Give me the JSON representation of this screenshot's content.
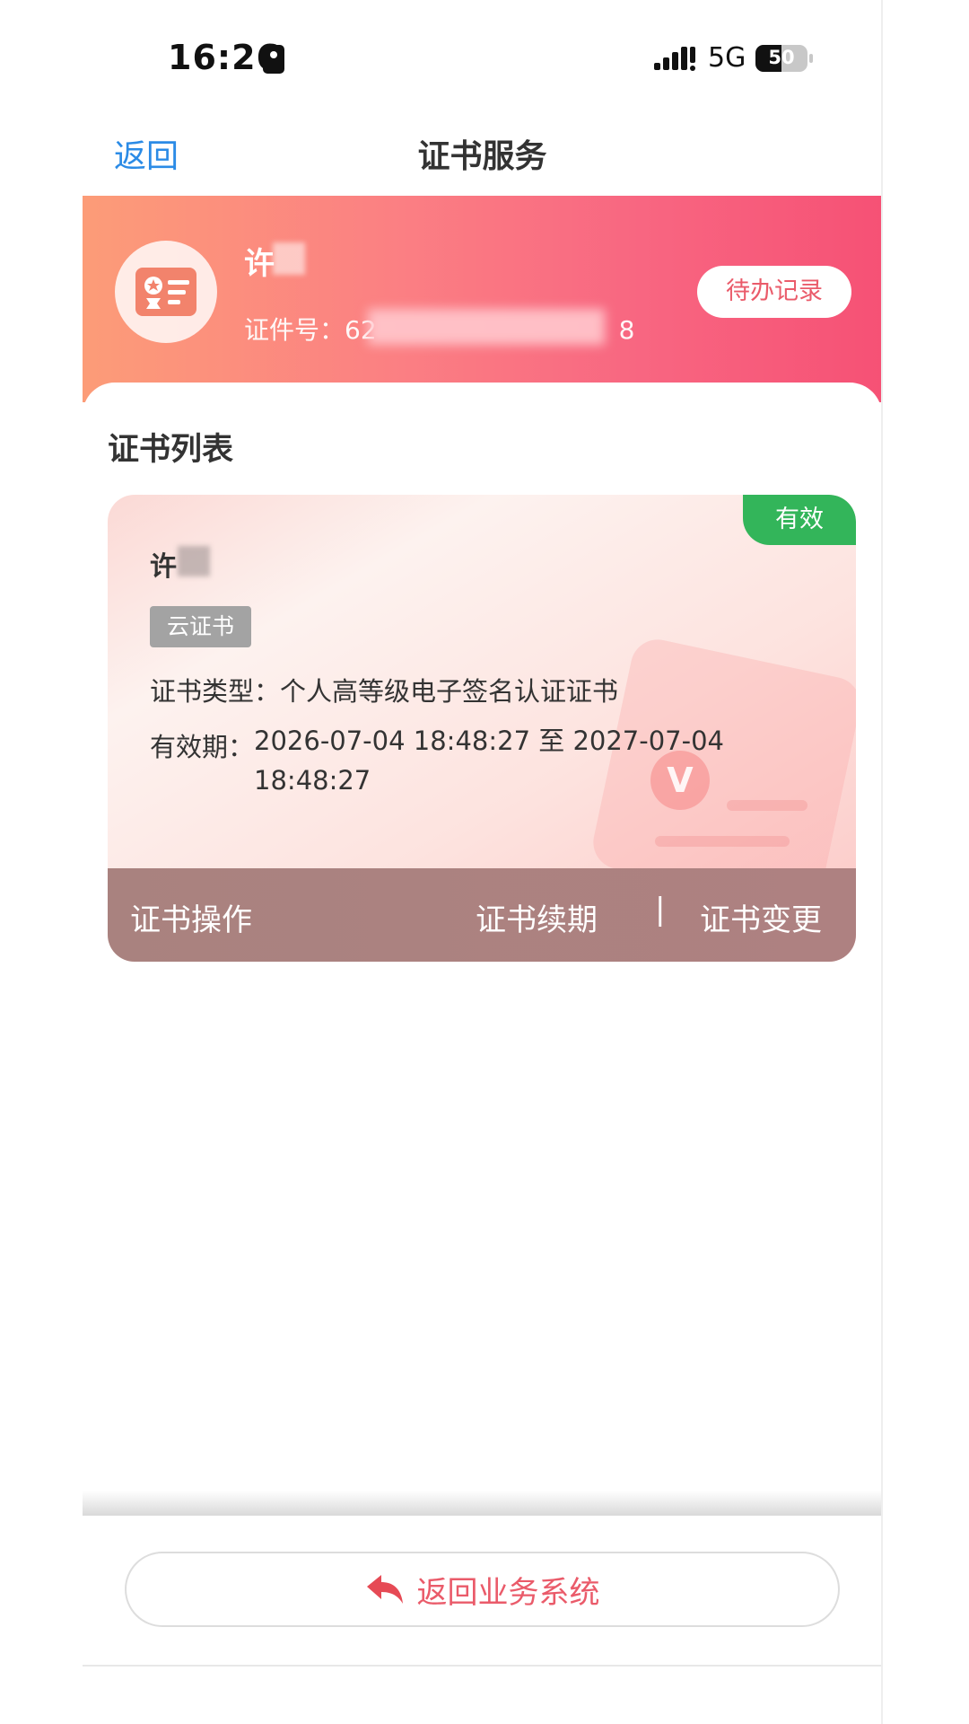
{
  "status_bar": {
    "time": "16:26",
    "network": "5G",
    "battery_level": "50",
    "battery_fraction": 0.5
  },
  "nav": {
    "back_label": "返回",
    "title": "证书服务"
  },
  "header": {
    "name": "许",
    "id_label": "证件号：",
    "id_value_visible": "62",
    "id_value_tail": "8",
    "todo_button_label": "待办记录"
  },
  "section": {
    "title": "证书列表"
  },
  "certificate": {
    "status_badge": "有效",
    "holder_name": "许",
    "tag": "云证书",
    "type_label": "证书类型：",
    "type_value": "个人高等级电子签名认证证书",
    "validity_label": "有效期：",
    "validity_value": "2026-07-04 18:48:27 至 2027-07-04 18:48:27",
    "seal_mark": "V",
    "actions": {
      "label": "证书操作",
      "renew": "证书续期",
      "separator": "|",
      "change": "证书变更"
    }
  },
  "footer": {
    "return_button_label": "返回业务系统"
  },
  "icons": {
    "status_sim": "sim-icon",
    "signal": "signal-icon",
    "battery": "battery-icon",
    "avatar": "id-card-icon",
    "return": "reply-arrow-icon"
  },
  "colors": {
    "accent_blue": "#2b8be6",
    "banner_start": "#fc9c78",
    "banner_end": "#f65175",
    "valid_green": "#33b55a",
    "accent_red": "#ea5b6a"
  }
}
